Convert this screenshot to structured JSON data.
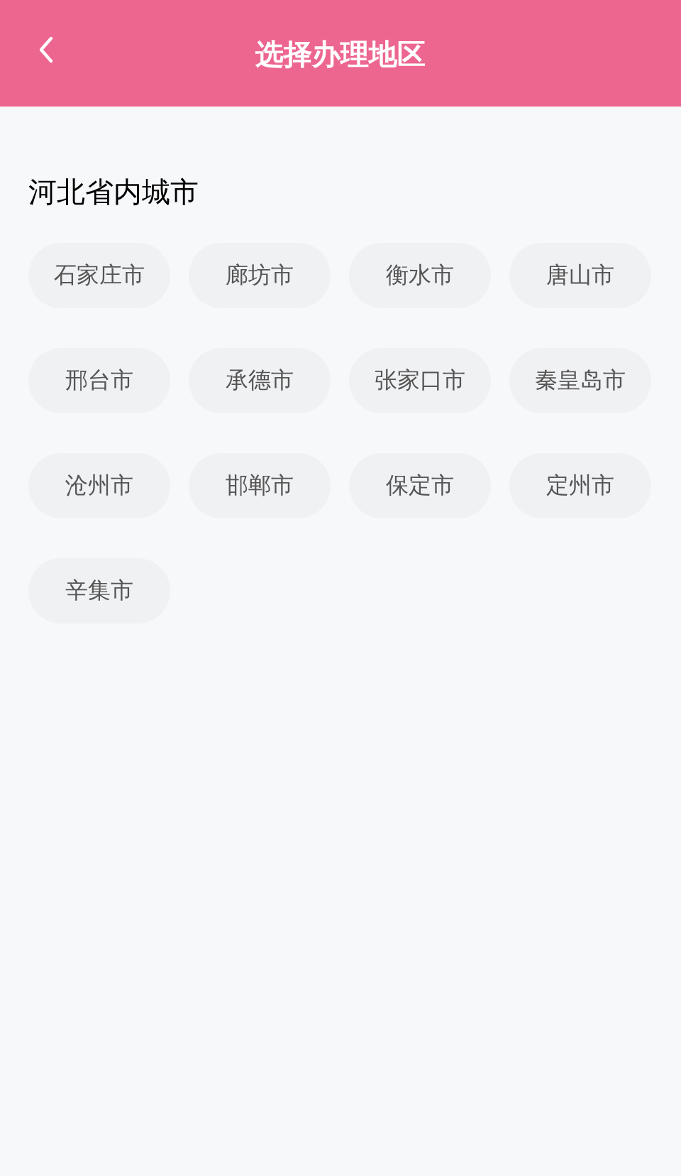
{
  "header": {
    "title": "选择办理地区"
  },
  "section": {
    "title": "河北省内城市"
  },
  "cities": [
    "石家庄市",
    "廊坊市",
    "衡水市",
    "唐山市",
    "邢台市",
    "承德市",
    "张家口市",
    "秦皇岛市",
    "沧州市",
    "邯郸市",
    "保定市",
    "定州市",
    "辛集市"
  ]
}
